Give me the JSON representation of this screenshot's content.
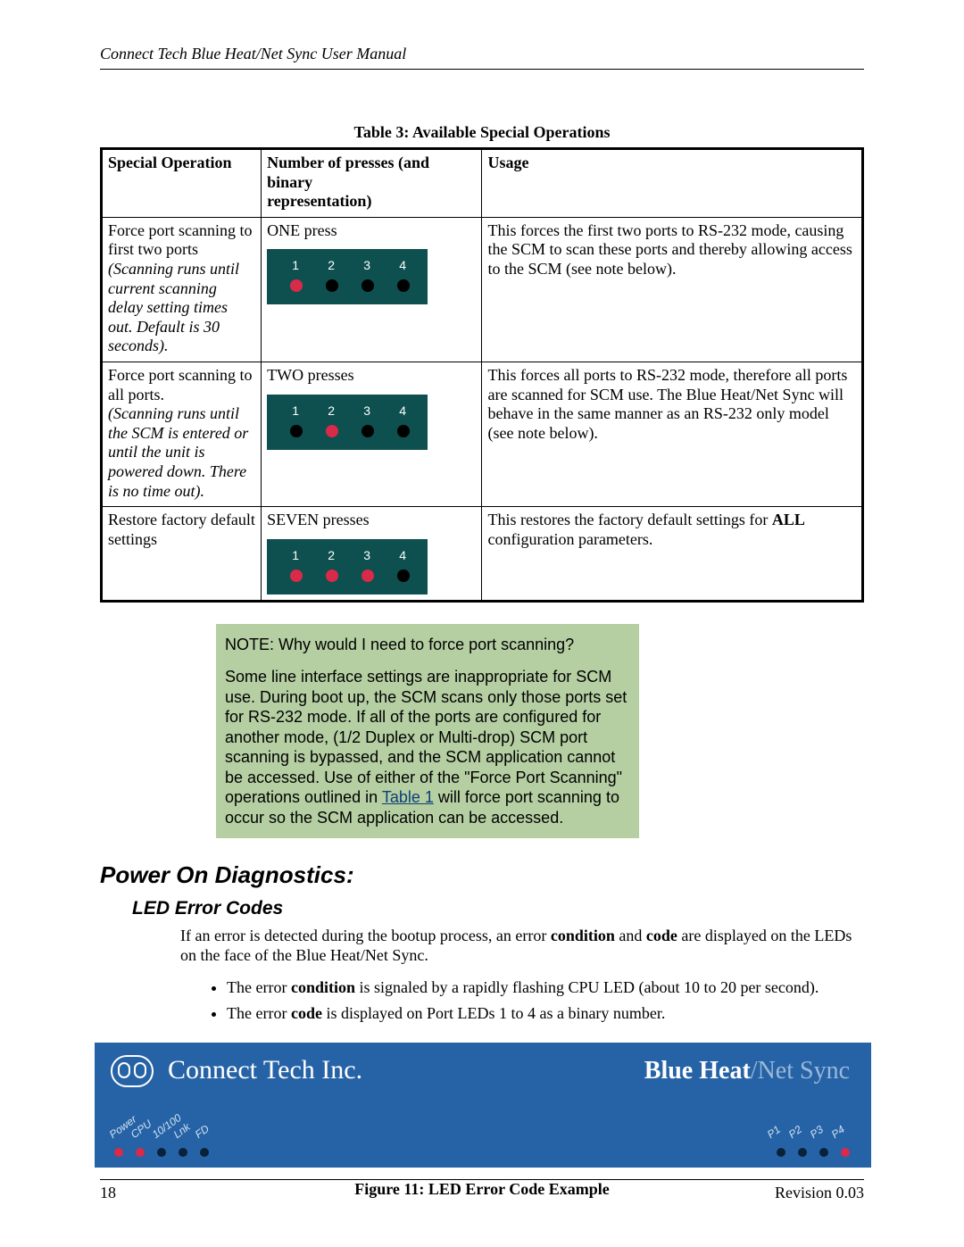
{
  "header": "Connect Tech Blue Heat/Net Sync User Manual",
  "table": {
    "caption": "Table 3: Available Special Operations",
    "headers": {
      "col1": "Special Operation",
      "col2_line1": "Number of presses (and binary",
      "col2_line2": "representation)",
      "col3": "Usage"
    },
    "rows": [
      {
        "op_main": "Force port scanning to first two ports",
        "op_note": "(Scanning runs until current scanning delay setting times out. Default is 30 seconds).",
        "presses": "ONE press",
        "leds": [
          "on",
          "off",
          "off",
          "off"
        ],
        "usage": "This forces the first two ports to RS-232 mode, causing the SCM to scan these ports and thereby allowing access to the SCM (see note below)."
      },
      {
        "op_main": "Force port scanning to all ports.",
        "op_note": "(Scanning runs until the SCM is entered or until the unit is powered down. There is no time out).",
        "presses": "TWO presses",
        "leds": [
          "off",
          "on",
          "off",
          "off"
        ],
        "usage": "This forces all ports to RS-232 mode, therefore all ports are scanned for SCM use. The Blue Heat/Net Sync will behave in the same manner as an RS-232 only model (see note below)."
      },
      {
        "op_main": "Restore factory default settings",
        "op_note": "",
        "presses": "SEVEN  presses",
        "leds": [
          "on",
          "on",
          "on",
          "off"
        ],
        "usage_prefix": "This restores the factory default settings for ",
        "usage_bold": "ALL",
        "usage_suffix": " configuration parameters."
      }
    ],
    "led_labels": [
      "1",
      "2",
      "3",
      "4"
    ]
  },
  "note": {
    "title": "NOTE: Why would I need to force port scanning?",
    "body_before_link": "Some line interface settings are inappropriate for SCM use. During boot up, the SCM scans only those ports set for RS-232 mode. If all of the ports are configured for another mode, (1/2 Duplex or Multi-drop) SCM port scanning is bypassed, and the SCM application cannot be accessed. Use of either of the \"Force Port Scanning\" operations outlined in ",
    "link_text": "Table 1",
    "body_after_link": " will force port scanning to occur so the SCM application can be accessed."
  },
  "sections": {
    "h2": "Power On Diagnostics:",
    "h3": "LED Error Codes",
    "intro_before": "If an error is detected during the bootup process, an error ",
    "intro_b1": "condition",
    "intro_mid": " and ",
    "intro_b2": "code",
    "intro_after": " are displayed on the LEDs on the face of the Blue Heat/Net Sync.",
    "bullets": [
      {
        "pre": "The error ",
        "b": "condition",
        "post": " is signaled by a rapidly flashing CPU LED (about 10 to 20 per second)."
      },
      {
        "pre": "The error ",
        "b": "code",
        "post": " is displayed on Port LEDs 1 to 4 as a binary number."
      }
    ]
  },
  "product_panel": {
    "company": "Connect Tech Inc.",
    "product_main": "Blue Heat",
    "product_slash": "/",
    "product_faint": "Net Sync",
    "left_labels": [
      "Power",
      "CPU",
      "10/100",
      "Lnk",
      "FD"
    ],
    "left_dots": [
      "on",
      "on",
      "off",
      "off",
      "off"
    ],
    "right_labels": [
      "P1",
      "P2",
      "P3",
      "P4"
    ],
    "right_dots": [
      "off",
      "off",
      "off",
      "on"
    ]
  },
  "figure_caption": "Figure 11: LED Error Code Example",
  "footer": {
    "page": "18",
    "revision": "Revision 0.03"
  }
}
